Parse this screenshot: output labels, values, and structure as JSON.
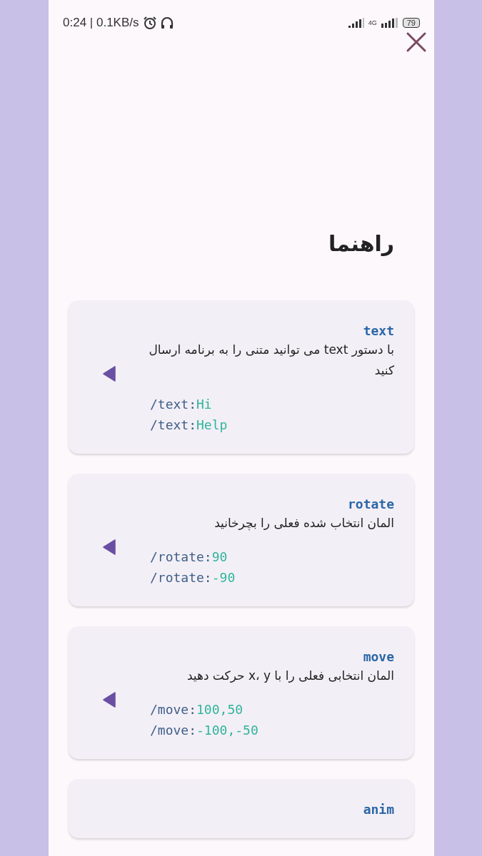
{
  "status_bar": {
    "time_speed": "0:24 | 0.1KB/s",
    "network": "4G",
    "battery": "79"
  },
  "title": "راهنما",
  "commands": [
    {
      "name": "text",
      "description": "با دستور text می توانید متنی را به برنامه ارسال کنید",
      "examples": [
        {
          "command": "/text:",
          "argument": "Hi"
        },
        {
          "command": "/text:",
          "argument": "Help"
        }
      ]
    },
    {
      "name": "rotate",
      "description": "المان انتخاب شده فعلی را بچرخانید",
      "examples": [
        {
          "command": "/rotate:",
          "argument": "90"
        },
        {
          "command": "/rotate:",
          "argument": "-90"
        }
      ]
    },
    {
      "name": "move",
      "description": "المان انتخابی فعلی را با x، y حرکت دهید",
      "examples": [
        {
          "command": "/move:",
          "argument": "100,50"
        },
        {
          "command": "/move:",
          "argument": "-100,-50"
        }
      ]
    },
    {
      "name": "anim"
    }
  ]
}
